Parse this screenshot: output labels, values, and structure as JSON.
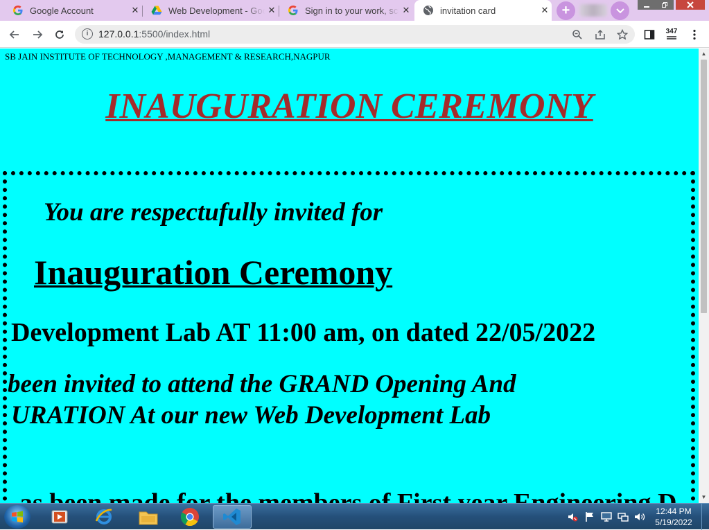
{
  "browser": {
    "tabs": [
      {
        "label": "Google Account",
        "icon": "google-g-icon",
        "active": false
      },
      {
        "label": "Web Development - Goo",
        "icon": "google-drive-icon",
        "active": false
      },
      {
        "label": "Sign in to your work, sch",
        "icon": "google-g-icon",
        "active": false
      },
      {
        "label": "invitation card",
        "icon": "globe-icon",
        "active": true
      }
    ],
    "new_tab_symbol": "+",
    "tab_close_symbol": "✕",
    "url_host": "127.0.0.1",
    "url_path": ":5500/index.html",
    "extension_badge": "347",
    "colors": {
      "tabstrip": "#e3c9ee",
      "accent": "#c994df"
    }
  },
  "page": {
    "institute": "SB JAIN INSTITUTE OF TECHNOLOGY ,MANAGEMENT & RESEARCH,NAGPUR",
    "heading": "INAUGURATION CEREMONY",
    "invite_line": "You are respectufully invited for",
    "event_title": "Inauguration Ceremony",
    "date_line": "Development Lab AT 11:00 am, on dated 22/05/2022",
    "invited_line_1": "been invited to attend the GRAND Opening And",
    "invited_line_2": "URATION At our new Web Development Lab",
    "partial_line": "as been made for the members of First year Engineering D",
    "colors": {
      "background": "#00ffff",
      "heading": "#a52a2a",
      "text": "#000000"
    }
  },
  "taskbar": {
    "apps": [
      "media-player-icon",
      "internet-explorer-icon",
      "file-explorer-icon",
      "chrome-icon",
      "vscode-icon"
    ],
    "time": "12:44 PM",
    "date": "5/19/2022"
  }
}
